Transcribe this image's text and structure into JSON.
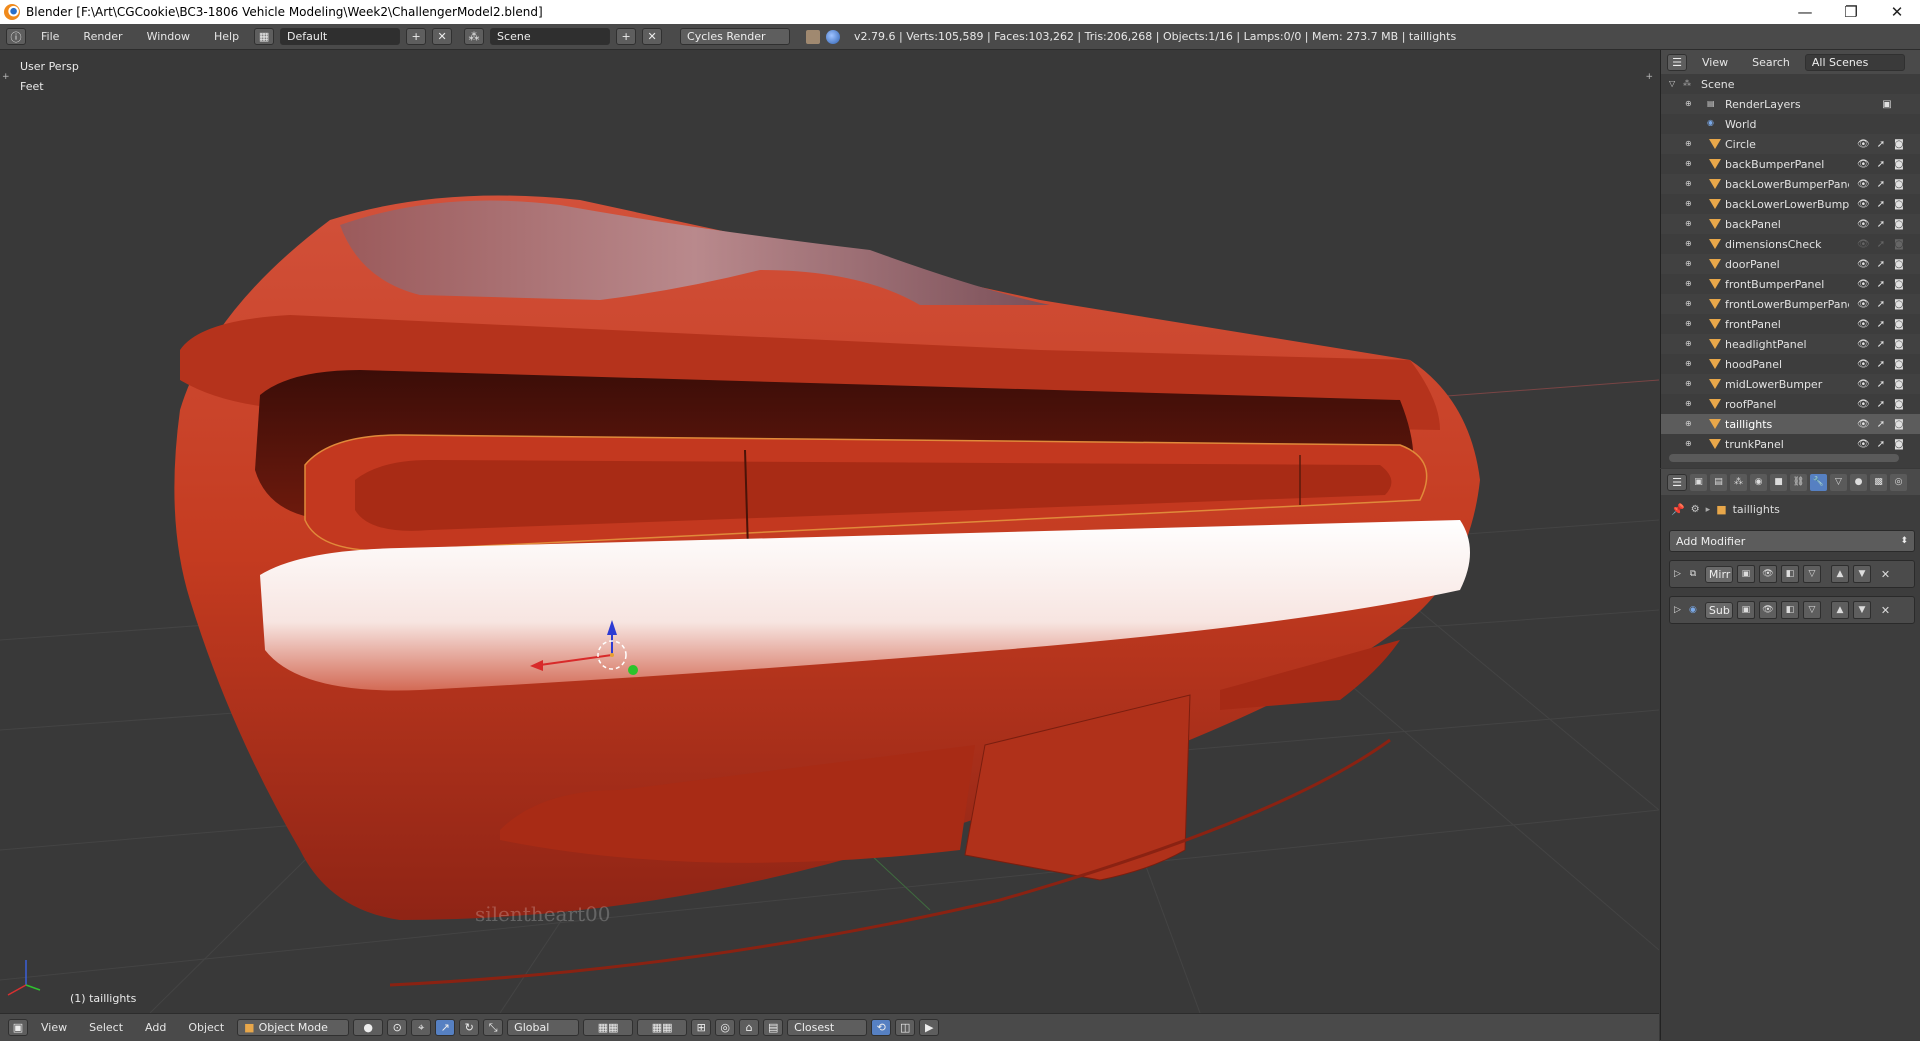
{
  "window": {
    "title": "Blender [F:\\Art\\CGCookie\\BC3-1806 Vehicle Modeling\\Week2\\ChallengerModel2.blend]",
    "minimize": "—",
    "maximize": "❐",
    "close": "✕"
  },
  "info_header": {
    "menus": [
      "File",
      "Render",
      "Window",
      "Help"
    ],
    "layout": "Default",
    "scene": "Scene",
    "render_engine": "Cycles Render",
    "stats": "v2.79.6 | Verts:105,589 | Faces:103,262 | Tris:206,268 | Objects:1/16 | Lamps:0/0 | Mem: 273.7 MB | taillights"
  },
  "viewport": {
    "view_name": "User Persp",
    "units": "Feet",
    "active_object_label": "(1) taillights",
    "watermark": "silentheart00",
    "colors": {
      "body": "#c53a21",
      "background": "#393939"
    }
  },
  "bottom_toolbar": {
    "menus": [
      "View",
      "Select",
      "Add",
      "Object"
    ],
    "mode": "Object Mode",
    "orientation": "Global",
    "snap_target": "Closest"
  },
  "outliner": {
    "menus": [
      "View",
      "Search"
    ],
    "display_mode": "All Scenes",
    "scene": "Scene",
    "items": [
      {
        "name": "RenderLayers",
        "type": "renderlayers"
      },
      {
        "name": "World",
        "type": "world"
      },
      {
        "name": "Circle",
        "type": "object"
      },
      {
        "name": "backBumperPanel",
        "type": "object"
      },
      {
        "name": "backLowerBumperPanel",
        "type": "object"
      },
      {
        "name": "backLowerLowerBumper",
        "type": "object"
      },
      {
        "name": "backPanel",
        "type": "object"
      },
      {
        "name": "dimensionsCheck",
        "type": "object"
      },
      {
        "name": "doorPanel",
        "type": "object"
      },
      {
        "name": "frontBumperPanel",
        "type": "object"
      },
      {
        "name": "frontLowerBumperPanel",
        "type": "object"
      },
      {
        "name": "frontPanel",
        "type": "object"
      },
      {
        "name": "headlightPanel",
        "type": "object"
      },
      {
        "name": "hoodPanel",
        "type": "object"
      },
      {
        "name": "midLowerBumper",
        "type": "object"
      },
      {
        "name": "roofPanel",
        "type": "object"
      },
      {
        "name": "taillights",
        "type": "object",
        "selected": true
      },
      {
        "name": "trunkPanel",
        "type": "object"
      }
    ]
  },
  "properties": {
    "object_name": "taillights",
    "add_modifier_label": "Add Modifier",
    "modifiers": [
      {
        "short_name": "Mirr"
      },
      {
        "short_name": "Sub"
      }
    ],
    "accent_color": "#5680c2"
  }
}
